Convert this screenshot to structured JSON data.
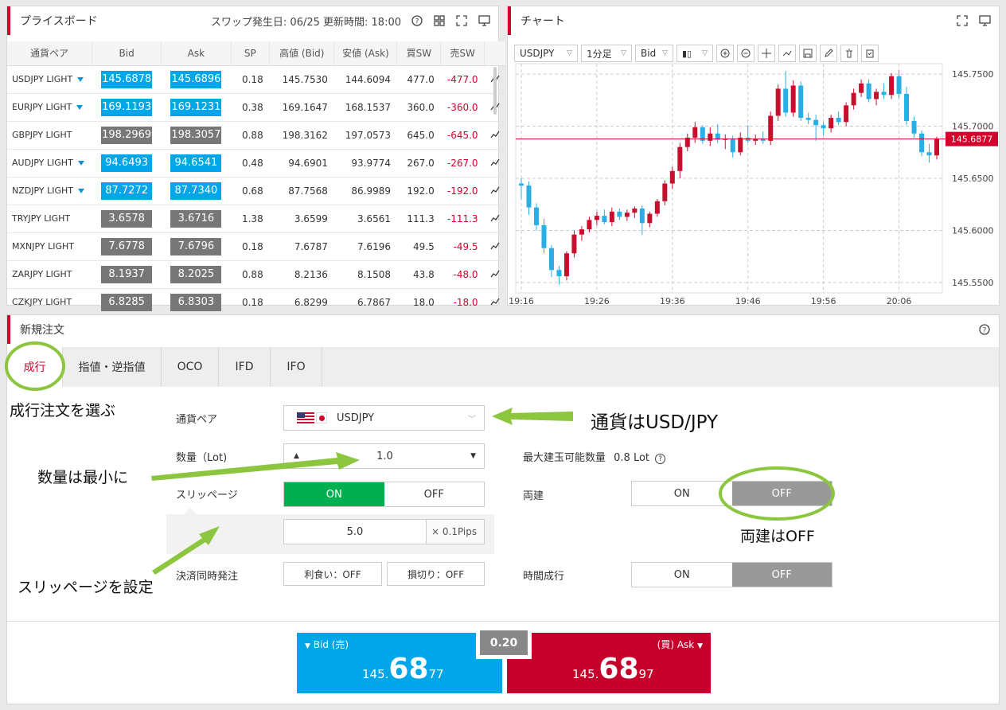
{
  "priceboard": {
    "title": "プライスボード",
    "swap_info": "スワップ発生日: 06/25 更新時間: 18:00",
    "headers": [
      "通貨ペア",
      "Bid",
      "Ask",
      "SP",
      "高値 (Bid)",
      "安値 (Ask)",
      "買SW",
      "売SW"
    ],
    "rows": [
      {
        "pair": "USDJPY LIGHT",
        "bid": "145.6878",
        "ask": "145.6896",
        "sp": "0.18",
        "high": "145.7530",
        "low": "144.6094",
        "buy_sw": "477.0",
        "sell_sw": "-477.0",
        "arrow": true,
        "color": "blue"
      },
      {
        "pair": "EURJPY LIGHT",
        "bid": "169.1193",
        "ask": "169.1231",
        "sp": "0.38",
        "high": "169.1647",
        "low": "168.1537",
        "buy_sw": "360.0",
        "sell_sw": "-360.0",
        "arrow": true,
        "color": "blue"
      },
      {
        "pair": "GBPJPY LIGHT",
        "bid": "198.2969",
        "ask": "198.3057",
        "sp": "0.88",
        "high": "198.3162",
        "low": "197.0573",
        "buy_sw": "645.0",
        "sell_sw": "-645.0",
        "arrow": false,
        "color": "gray"
      },
      {
        "pair": "AUDJPY LIGHT",
        "bid": "94.6493",
        "ask": "94.6541",
        "sp": "0.48",
        "high": "94.6901",
        "low": "93.9774",
        "buy_sw": "267.0",
        "sell_sw": "-267.0",
        "arrow": true,
        "color": "blue"
      },
      {
        "pair": "NZDJPY LIGHT",
        "bid": "87.7272",
        "ask": "87.7340",
        "sp": "0.68",
        "high": "87.7568",
        "low": "86.9989",
        "buy_sw": "192.0",
        "sell_sw": "-192.0",
        "arrow": true,
        "color": "blue"
      },
      {
        "pair": "TRYJPY LIGHT",
        "bid": "3.6578",
        "ask": "3.6716",
        "sp": "1.38",
        "high": "3.6599",
        "low": "3.6561",
        "buy_sw": "111.3",
        "sell_sw": "-111.3",
        "arrow": false,
        "color": "gray"
      },
      {
        "pair": "MXNJPY LIGHT",
        "bid": "7.6778",
        "ask": "7.6796",
        "sp": "0.18",
        "high": "7.6787",
        "low": "7.6196",
        "buy_sw": "49.5",
        "sell_sw": "-49.5",
        "arrow": false,
        "color": "gray"
      },
      {
        "pair": "ZARJPY LIGHT",
        "bid": "8.1937",
        "ask": "8.2025",
        "sp": "0.88",
        "high": "8.2136",
        "low": "8.1508",
        "buy_sw": "43.8",
        "sell_sw": "-48.0",
        "arrow": false,
        "color": "gray"
      },
      {
        "pair": "CZKJPY LIGHT",
        "bid": "6.8285",
        "ask": "6.8303",
        "sp": "0.18",
        "high": "6.8299",
        "low": "6.7867",
        "buy_sw": "18.0",
        "sell_sw": "-18.0",
        "arrow": false,
        "color": "gray"
      }
    ]
  },
  "chart": {
    "title": "チャート",
    "toolbar": {
      "symbol": "USDJPY",
      "interval": "1分足",
      "side": "Bid"
    },
    "current_price": "145.6877"
  },
  "chart_data": {
    "type": "candlestick",
    "x_ticks": [
      "19:16",
      "19:26",
      "19:36",
      "19:46",
      "19:56",
      "20:06"
    ],
    "y_ticks": [
      "145.7500",
      "145.7000",
      "145.6500",
      "145.6000",
      "145.5500"
    ],
    "ylim": [
      145.54,
      145.76
    ],
    "current_price": 145.6877,
    "grid": true,
    "candles": [
      [
        145.645,
        145.65,
        145.63,
        145.643
      ],
      [
        145.643,
        145.647,
        145.615,
        145.622
      ],
      [
        145.622,
        145.626,
        145.6,
        145.605
      ],
      [
        145.605,
        145.611,
        145.578,
        145.583
      ],
      [
        145.583,
        145.586,
        145.555,
        145.562
      ],
      [
        145.562,
        145.566,
        145.548,
        145.556
      ],
      [
        145.556,
        145.58,
        145.552,
        145.578
      ],
      [
        145.578,
        145.6,
        145.574,
        145.596
      ],
      [
        145.596,
        145.604,
        145.59,
        145.601
      ],
      [
        145.601,
        145.613,
        145.598,
        145.61
      ],
      [
        145.61,
        145.618,
        145.605,
        145.614
      ],
      [
        145.614,
        145.62,
        145.606,
        145.608
      ],
      [
        145.608,
        145.622,
        145.604,
        145.618
      ],
      [
        145.618,
        145.621,
        145.61,
        145.613
      ],
      [
        145.613,
        145.62,
        145.609,
        145.617
      ],
      [
        145.617,
        145.623,
        145.612,
        145.621
      ],
      [
        145.621,
        145.624,
        145.596,
        145.607
      ],
      [
        145.607,
        145.618,
        145.603,
        145.616
      ],
      [
        145.616,
        145.63,
        145.613,
        145.628
      ],
      [
        145.628,
        145.648,
        145.624,
        145.645
      ],
      [
        145.645,
        145.661,
        145.64,
        145.657
      ],
      [
        145.657,
        145.684,
        145.65,
        145.68
      ],
      [
        145.68,
        145.693,
        145.676,
        145.689
      ],
      [
        145.689,
        145.704,
        145.684,
        145.699
      ],
      [
        145.699,
        145.701,
        145.683,
        145.686
      ],
      [
        145.686,
        145.699,
        145.681,
        145.693
      ],
      [
        145.693,
        145.702,
        145.684,
        145.687
      ],
      [
        145.687,
        145.692,
        145.678,
        145.688
      ],
      [
        145.688,
        145.691,
        145.67,
        145.675
      ],
      [
        145.675,
        145.694,
        145.672,
        145.689
      ],
      [
        145.689,
        145.701,
        145.684,
        145.686
      ],
      [
        145.686,
        145.692,
        145.682,
        145.688
      ],
      [
        145.688,
        145.695,
        145.683,
        145.686
      ],
      [
        145.686,
        145.714,
        145.682,
        145.71
      ],
      [
        145.71,
        145.74,
        145.705,
        145.736
      ],
      [
        145.736,
        145.753,
        145.709,
        145.713
      ],
      [
        145.713,
        145.744,
        145.709,
        145.739
      ],
      [
        145.739,
        145.743,
        145.705,
        145.708
      ],
      [
        145.708,
        145.713,
        145.702,
        145.706
      ],
      [
        145.706,
        145.711,
        145.686,
        145.701
      ],
      [
        145.701,
        145.704,
        145.691,
        145.698
      ],
      [
        145.698,
        145.711,
        145.694,
        145.708
      ],
      [
        145.708,
        145.714,
        145.701,
        145.704
      ],
      [
        145.704,
        145.723,
        145.7,
        145.72
      ],
      [
        145.72,
        145.736,
        145.716,
        145.732
      ],
      [
        145.732,
        145.745,
        145.728,
        145.741
      ],
      [
        145.741,
        145.745,
        145.723,
        145.726
      ],
      [
        145.726,
        145.736,
        145.72,
        145.733
      ],
      [
        145.733,
        145.741,
        145.726,
        145.73
      ],
      [
        145.73,
        145.751,
        145.726,
        145.748
      ],
      [
        145.748,
        145.754,
        145.727,
        145.731
      ],
      [
        145.731,
        145.738,
        145.701,
        145.705
      ],
      [
        145.705,
        145.709,
        145.689,
        145.693
      ],
      [
        145.693,
        145.696,
        145.671,
        145.675
      ],
      [
        145.675,
        145.683,
        145.665,
        145.672
      ],
      [
        145.672,
        145.69,
        145.668,
        145.688
      ]
    ]
  },
  "order": {
    "title": "新規注文",
    "tabs": [
      "成行",
      "指値・逆指値",
      "OCO",
      "IFD",
      "IFO"
    ],
    "pair_label": "通貨ペア",
    "pair_value": "USDJPY",
    "qty_label": "数量（Lot)",
    "qty_value": "1.0",
    "max_label": "最大建玉可能数量",
    "max_value": "0.8 Lot",
    "slip_label": "スリッページ",
    "on": "ON",
    "off": "OFF",
    "slip_value": "5.0",
    "slip_unit": "× 0.1Pips",
    "hedge_label": "両建",
    "settle_label": "決済同時発注",
    "take_profit": "利食い：OFF",
    "stop_loss": "損切り：OFF",
    "time_label": "時間成行",
    "bid_label": "Bid (売)",
    "ask_label": "(買) Ask",
    "spread": "0.20",
    "bid_small": "145.",
    "bid_big": "68",
    "bid_tail": "77",
    "ask_small": "145.",
    "ask_big": "68",
    "ask_tail": "97"
  },
  "annotations": {
    "market": "成行注文を選ぶ",
    "pair": "通貨はUSD/JPY",
    "qty": "数量は最小に",
    "hedge": "両建はOFF",
    "slip": "スリッページを設定"
  },
  "colors": {
    "accent": "#d3002b",
    "blue": "#00a6e8",
    "green": "#00b050",
    "annot": "#8cc63f"
  }
}
